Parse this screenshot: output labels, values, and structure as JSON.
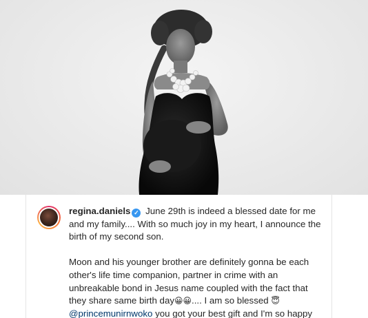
{
  "post": {
    "username": "regina.daniels",
    "verified_icon": "verified-badge-icon",
    "caption_first": "June 29th is indeed a blessed date for me and my family.... With so much joy in my heart, I announce the birth of my second son.",
    "caption_second_a": "Moon and his younger brother are definitely gonna be each other's life time companion, partner in crime with an unbreakable bond in Jesus name coupled with the fact that they share same birth day",
    "emoji_grin": "😀😀",
    "caption_second_b": ".... I am so blessed ",
    "emoji_halo": "😇",
    "mention": "@princemunirnwoko",
    "caption_second_c": " you got your best gift and I'm so happy you get very excited when you see babies ",
    "emoji_baby": "👶"
  }
}
